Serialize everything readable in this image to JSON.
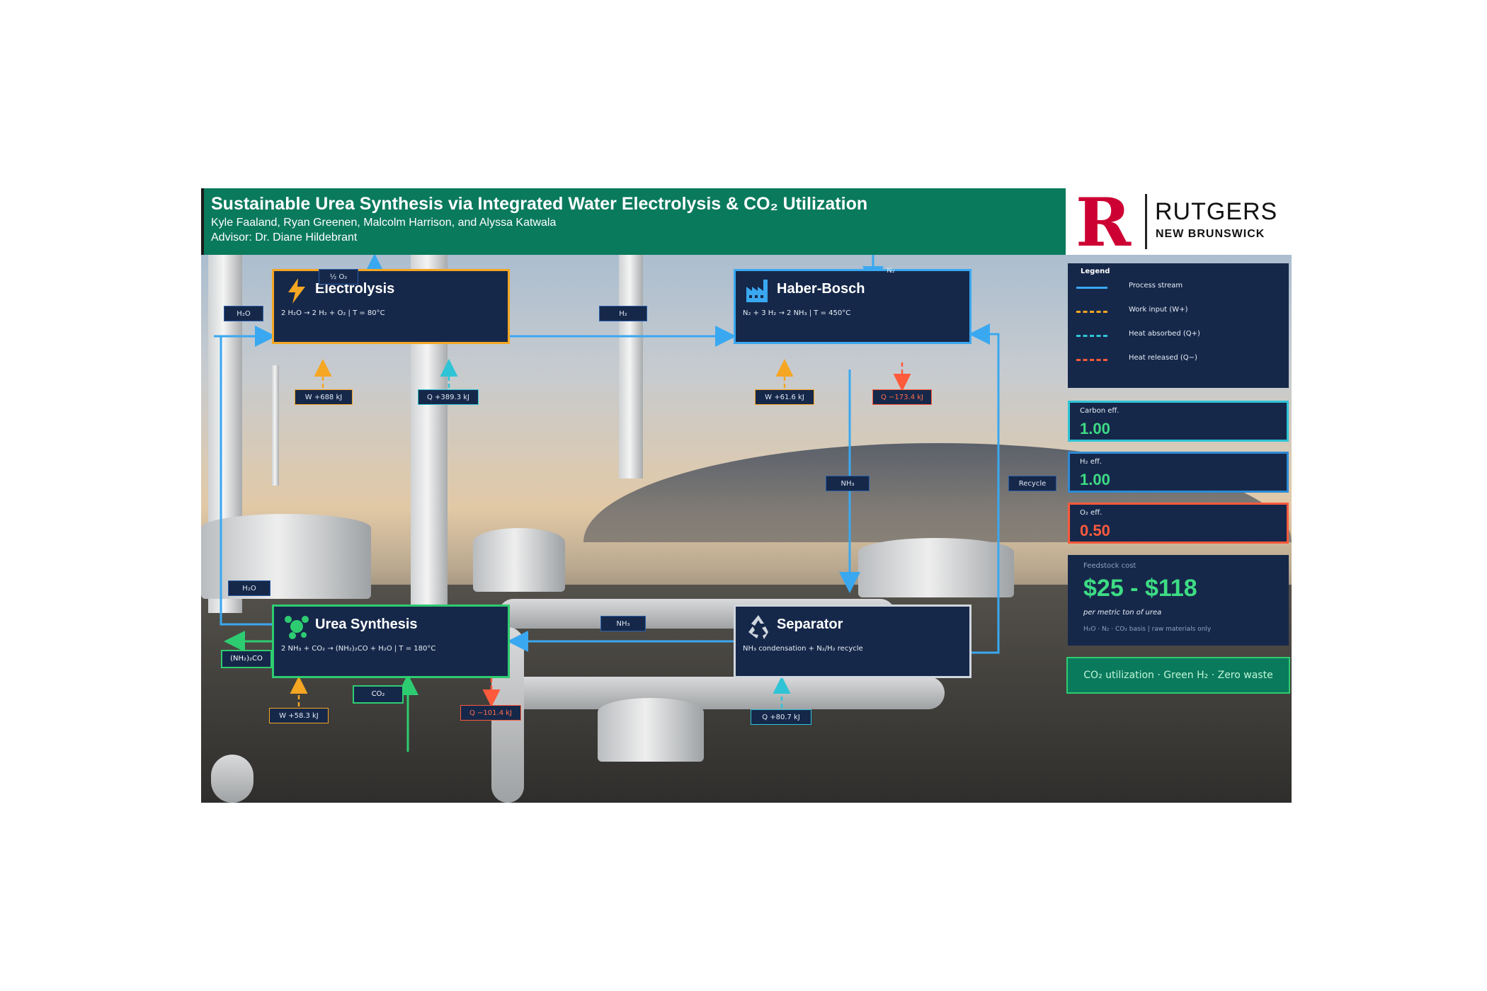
{
  "header": {
    "title": "Sustainable Urea Synthesis via Integrated Water Electrolysis & CO₂ Utilization",
    "authors": "Kyle Faaland, Ryan Greenen, Malcolm Harrison, and Alyssa Katwala",
    "advisor": "Advisor: Dr. Diane Hildebrant"
  },
  "logo": {
    "letter": "R",
    "name": "RUTGERS",
    "campus": "NEW BRUNSWICK"
  },
  "units": {
    "electrolysis": {
      "title": "Electrolysis",
      "equation": "2 H₂O → 2 H₂ + O₂   |   T = 80°C",
      "icon": "lightning-icon",
      "color": "#f5a623"
    },
    "haber_bosch": {
      "title": "Haber-Bosch",
      "equation": "N₂ + 3 H₂ → 2 NH₃   |   T = 450°C",
      "icon": "factory-icon",
      "color": "#3aa8f0"
    },
    "urea_synthesis": {
      "title": "Urea Synthesis",
      "equation": "2 NH₃ + CO₂ → (NH₂)₂CO + H₂O   |   T = 180°C",
      "icon": "molecule-icon",
      "color": "#2ecc71"
    },
    "separator": {
      "title": "Separator",
      "equation": "NH₃ condensation  +  N₂/H₂ recycle",
      "icon": "recycle-icon",
      "color": "#d0d6de"
    }
  },
  "stream_labels": {
    "o2_out": "½ O₂",
    "h2o_in": "H₂O",
    "h2": "H₂",
    "n2_in": "N₂",
    "nh3": "NH₃",
    "recycle": "Recycle",
    "h2o_return": "H₂O",
    "nh3_to_urea": "NH₃",
    "urea_product": "(NH₂)₂CO",
    "co2_in": "CO₂"
  },
  "energy_tags": {
    "electrolysis_w": "W +688 kJ",
    "electrolysis_q": "Q +389.3 kJ",
    "haber_w": "W +61.6 kJ",
    "haber_q": "Q −173.4 kJ",
    "urea_w": "W +58.3 kJ",
    "urea_q": "Q −101.4 kJ",
    "separator_q": "Q +80.7 kJ"
  },
  "legend": {
    "title": "Legend",
    "items": [
      {
        "label": "Process stream",
        "color": "#3aa8f0",
        "style": "solid"
      },
      {
        "label": "Work input (W+)",
        "color": "#f5a623",
        "style": "dashed"
      },
      {
        "label": "Heat absorbed (Q+)",
        "color": "#2ec4d6",
        "style": "dashed"
      },
      {
        "label": "Heat released (Q−)",
        "color": "#ff5a3c",
        "style": "dashed"
      }
    ]
  },
  "metrics": [
    {
      "label": "Carbon eff.",
      "value": "1.00",
      "color": "#3ddc84",
      "border": "#2ec4d6"
    },
    {
      "label": "H₂ eff.",
      "value": "1.00",
      "color": "#3ddc84",
      "border": "#2e8bd6"
    },
    {
      "label": "O₂ eff.",
      "value": "0.50",
      "color": "#ff5a3c",
      "border": "#ff5a3c"
    }
  ],
  "cost": {
    "label": "Feedstock cost",
    "value": "$25 - $118",
    "unit": "per metric ton of urea",
    "note": "H₂O · N₂ · CO₂ basis  |  raw materials only"
  },
  "pill": "CO₂ utilization  ·  Green H₂  ·  Zero waste"
}
